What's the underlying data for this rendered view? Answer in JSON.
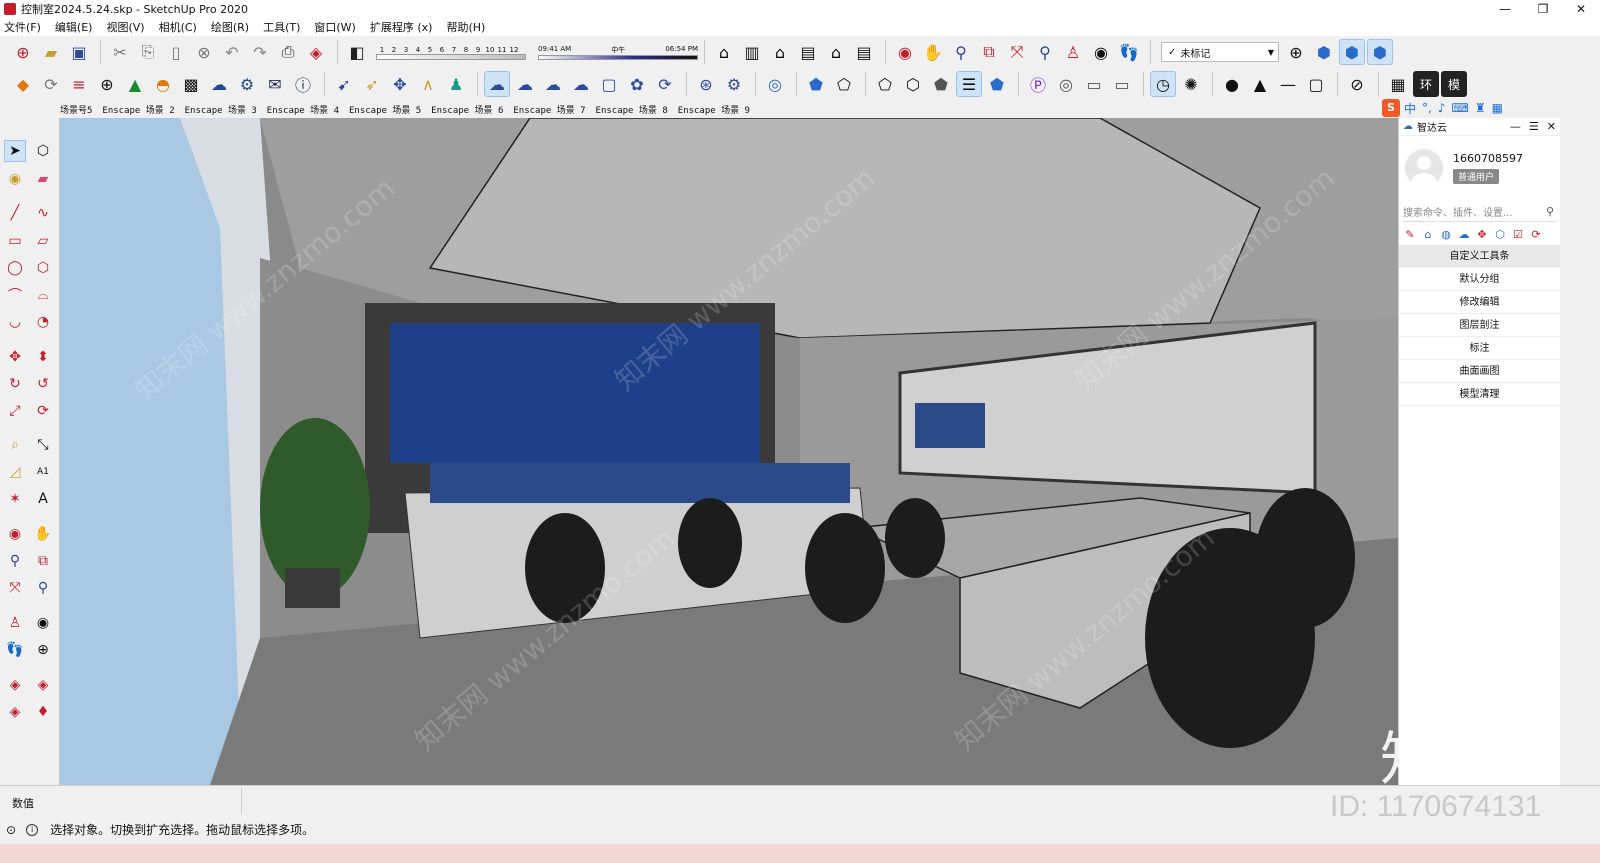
{
  "window": {
    "title": "控制室2024.5.24.skp - SketchUp Pro 2020",
    "minimize": "—",
    "restore": "❐",
    "close": "✕"
  },
  "menu": [
    "文件(F)",
    "编辑(E)",
    "视图(V)",
    "相机(C)",
    "绘图(R)",
    "工具(T)",
    "窗口(W)",
    "扩展程序 (x)",
    "帮助(H)"
  ],
  "shadow": {
    "months": [
      "1",
      "2",
      "3",
      "4",
      "5",
      "6",
      "7",
      "8",
      "9",
      "10",
      "11",
      "12"
    ],
    "time_start": "09:41 AM",
    "time_mid": "中午",
    "time_end": "06:54 PM"
  },
  "tag_select": {
    "value": "未标记"
  },
  "scene_tabs": [
    "场景号5",
    "Enscape 场景 2",
    "Enscape 场景 3",
    "Enscape 场景 4",
    "Enscape 场景 5",
    "Enscape 场景 6",
    "Enscape 场景 7",
    "Enscape 场景 8",
    "Enscape 场景 9"
  ],
  "ime": {
    "logo": "S",
    "mode": "中"
  },
  "panel": {
    "title": "智达云",
    "user_id": "1660708597",
    "user_badge": "普通用户",
    "search_placeholder": "搜索命令、插件、设置...",
    "menu": [
      "自定义工具条",
      "默认分组",
      "修改编辑",
      "图层剖注",
      "标注",
      "曲面画图",
      "模型清理"
    ]
  },
  "vcb": {
    "label": "数值"
  },
  "status": {
    "text": "选择对象。切换到扩充选择。拖动鼠标选择多项。"
  },
  "watermark": {
    "logo": "知末",
    "id": "ID: 1170674131",
    "text": "知末网 www.znzmo.com"
  }
}
